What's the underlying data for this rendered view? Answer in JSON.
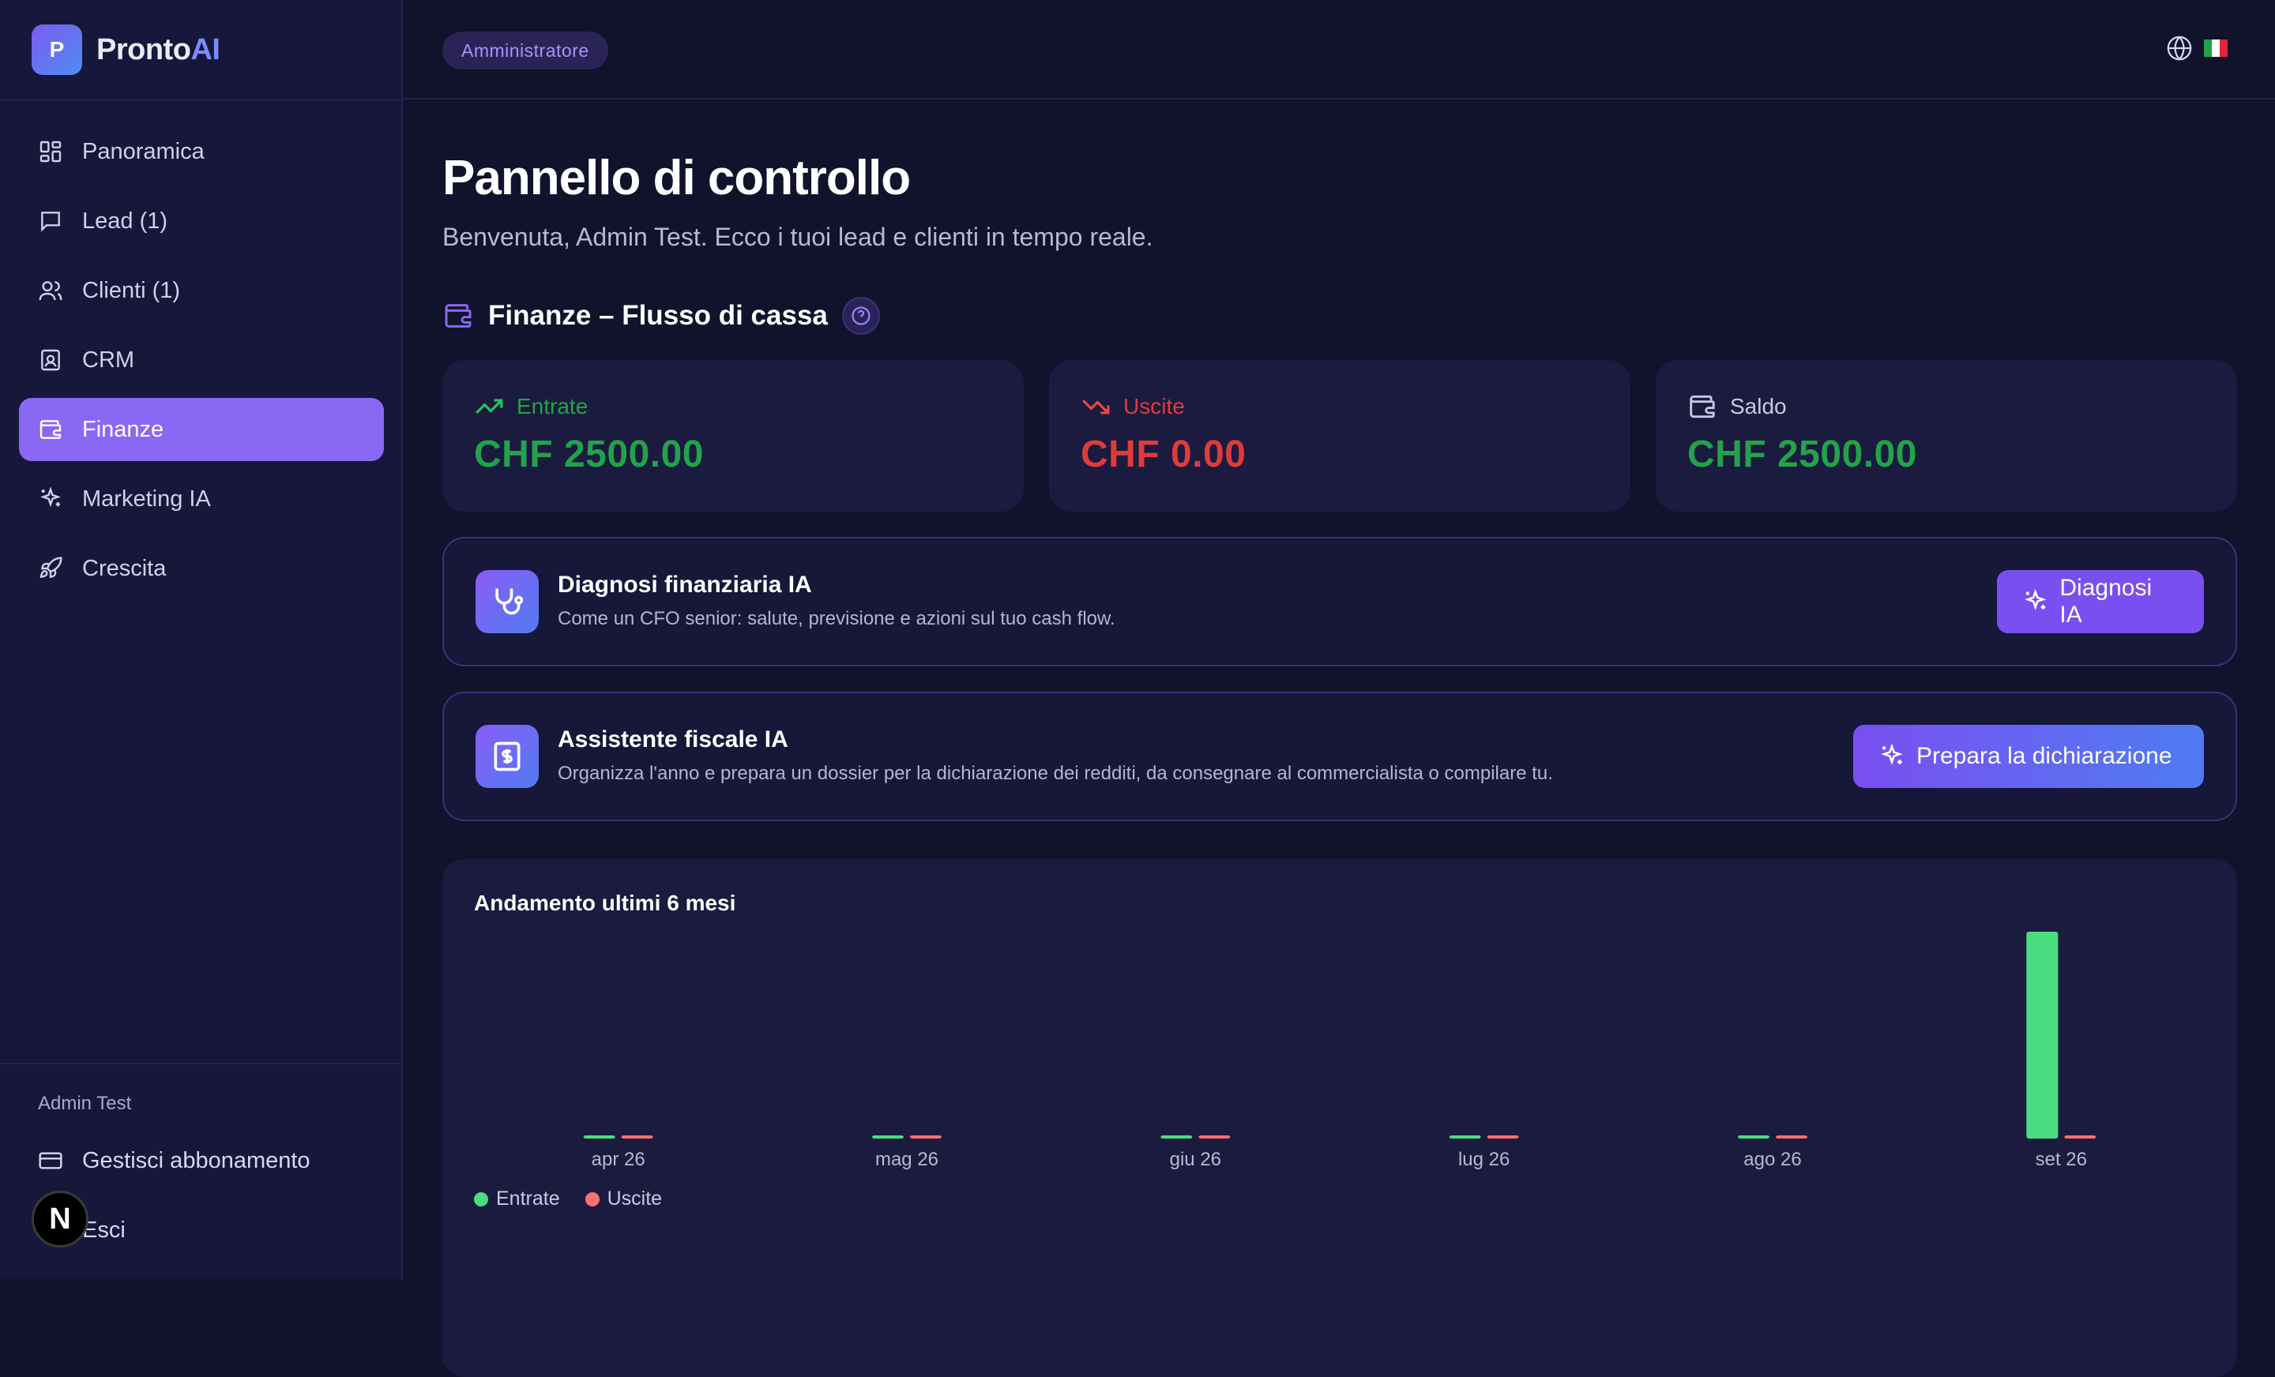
{
  "app": {
    "logo_letter": "P",
    "name_part1": "Pronto",
    "name_part2": "AI"
  },
  "sidebar": {
    "items": [
      {
        "label": "Panoramica",
        "icon": "grid-icon",
        "active": false
      },
      {
        "label": "Lead (1)",
        "icon": "message-icon",
        "active": false
      },
      {
        "label": "Clienti (1)",
        "icon": "users-icon",
        "active": false
      },
      {
        "label": "CRM",
        "icon": "contact-icon",
        "active": false
      },
      {
        "label": "Finanze",
        "icon": "wallet-icon",
        "active": true
      },
      {
        "label": "Marketing IA",
        "icon": "sparkles-icon",
        "active": false
      },
      {
        "label": "Crescita",
        "icon": "rocket-icon",
        "active": false
      }
    ],
    "user_name": "Admin Test",
    "manage_subscription": "Gestisci abbonamento",
    "logout": "Esci",
    "badge_letter": "N"
  },
  "topbar": {
    "role": "Amministratore",
    "language_icon": "globe-icon",
    "flag": "italy-flag"
  },
  "page": {
    "title": "Pannello di controllo",
    "subtitle": "Benvenuta, Admin Test. Ecco i tuoi lead e clienti in tempo reale."
  },
  "finance": {
    "section_title": "Finanze – Flusso di cassa",
    "income": {
      "label": "Entrate",
      "value": "CHF 2500.00",
      "color": "#22a34a"
    },
    "expenses": {
      "label": "Uscite",
      "value": "CHF 0.00",
      "color": "#e03b3b"
    },
    "balance": {
      "label": "Saldo",
      "value": "CHF 2500.00",
      "color": "#22a34a"
    }
  },
  "diagnosis": {
    "title": "Diagnosi finanziaria IA",
    "description": "Come un CFO senior: salute, previsione e azioni sul tuo cash flow.",
    "button": "Diagnosi IA"
  },
  "tax": {
    "title": "Assistente fiscale IA",
    "description": "Organizza l'anno e prepara un dossier per la dichiarazione dei redditi, da consegnare al commercialista o compilare tu.",
    "button": "Prepara la dichiarazione"
  },
  "chart_data": {
    "type": "bar",
    "title": "Andamento ultimi 6 mesi",
    "categories": [
      "apr 26",
      "mag 26",
      "giu 26",
      "lug 26",
      "ago 26",
      "set 26"
    ],
    "series": [
      {
        "name": "Entrate",
        "color": "#4ade80",
        "values": [
          0,
          0,
          0,
          0,
          0,
          2500
        ]
      },
      {
        "name": "Uscite",
        "color": "#f87171",
        "values": [
          0,
          0,
          0,
          0,
          0,
          0
        ]
      }
    ],
    "ylim": [
      0,
      2500
    ],
    "grid": false,
    "legend": "bottom-left"
  }
}
